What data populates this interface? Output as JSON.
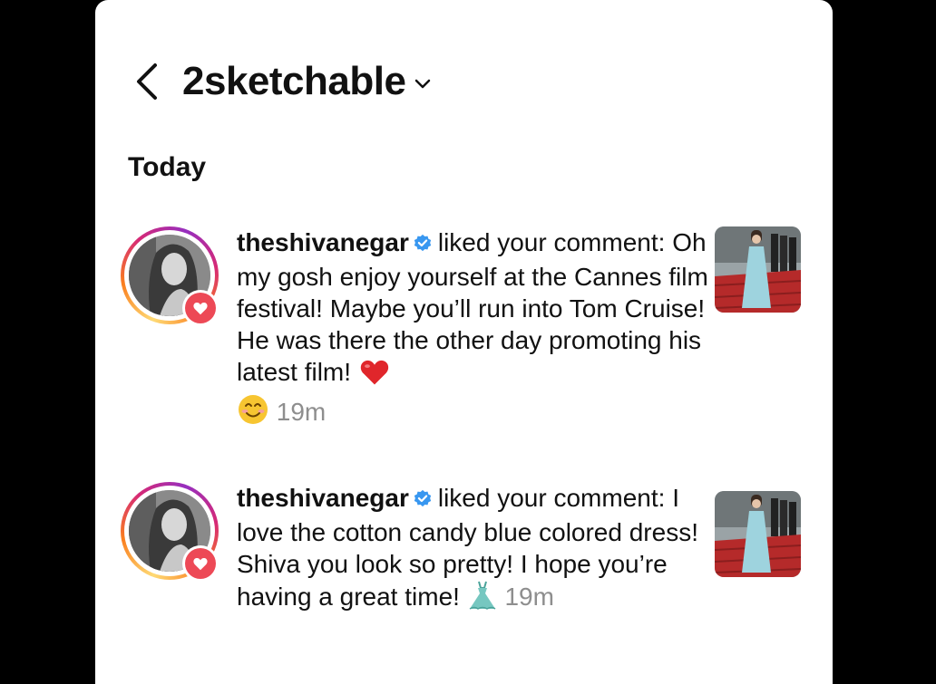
{
  "header": {
    "title": "2sketchable"
  },
  "section": {
    "today_label": "Today"
  },
  "notifications": [
    {
      "username": "theshivanegar",
      "action": "liked your comment:",
      "comment": "Oh my gosh enjoy yourself at the Cannes film festival! Maybe you’ll run into Tom Cruise! He was there the other day promoting his latest film!",
      "emojis": [
        "red-heart",
        "smiling-face"
      ],
      "time": "19m"
    },
    {
      "username": "theshivanegar",
      "action": "liked your comment:",
      "comment": "I love the cotton candy blue colored dress! Shiva you look so pretty! I hope you’re having a great time!",
      "emojis": [
        "dress"
      ],
      "time": "19m"
    }
  ],
  "icons": {
    "back": "chevron-left-icon",
    "dropdown": "chevron-down-icon",
    "verified": "verified-badge-icon",
    "like_badge": "heart-icon"
  },
  "colors": {
    "like_red": "#ed4956",
    "verified_blue": "#3897f0",
    "secondary_text": "#8e8e8e",
    "heart_emoji": "#e0262b",
    "dress_emoji": "#76c7c0"
  }
}
